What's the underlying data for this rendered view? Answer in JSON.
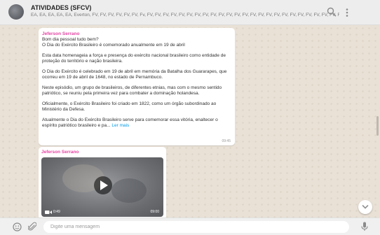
{
  "header": {
    "chat_title": "ATIVIDADES (SFCV)",
    "members": "EA, EA, EA, EA, EA, Everton, FV, FV, FV, FV, FV, FV, Fv, FV, FV, FV, FV, FV, FV, FV, FV, FV, FV, FV, FV, FV, FV, FV, FV, FV, FV, FV, FV, FV, FV, FV, FV, FV, FV, FV, FV, FV, FV, FV, FV, FV, FV...",
    "icons": [
      "search-icon",
      "menu-icon"
    ]
  },
  "messages": [
    {
      "sender": "Jeferson Serrano",
      "paragraphs": [
        "Bom dia pessoal tudo bem?\nO Dia do Exército Brasileiro é comemorado anualmente em 19 de abril",
        "Esta data homenageia a força e presença do exército nacional brasileiro como entidade de proteção do território e nação brasileira.",
        "O Dia do Exército é celebrado em 19 de abril em memória da Batalha dos Guararapes, que ocorreu em 19 de abril de 1648, no estado de Pernambuco.",
        "Neste episódio, um grupo de brasileiros, de diferentes etnias, mas com o mesmo sentido patriótico, se reuniu pela primeira vez para combater a dominação holandesa.",
        "Oficialmente, o Exército Brasileiro foi criado em 1822, como um órgão subordinado ao Ministério da Defesa.",
        "Atualmente o Dia do Exército Brasileiro serve para comemorar essa vitória, enaltecer o espírito patriótico brasileiro e pa..."
      ],
      "read_more": "Ler mais",
      "time": "09:45"
    },
    {
      "sender": "Jeferson Serrano",
      "video": {
        "duration": "0:49",
        "time": "09:00",
        "icons": [
          "play-icon",
          "video-camera-icon"
        ]
      }
    }
  ],
  "footer": {
    "placeholder": "Digite uma mensagem",
    "icons": [
      "emoji-icon",
      "attach-icon",
      "mic-icon"
    ]
  },
  "colors": {
    "header_bg": "#ededed",
    "chat_bg": "#e9e1d6",
    "sender_name": "#e542a3",
    "link": "#039be5",
    "footer_bg": "#f0f0f0"
  }
}
